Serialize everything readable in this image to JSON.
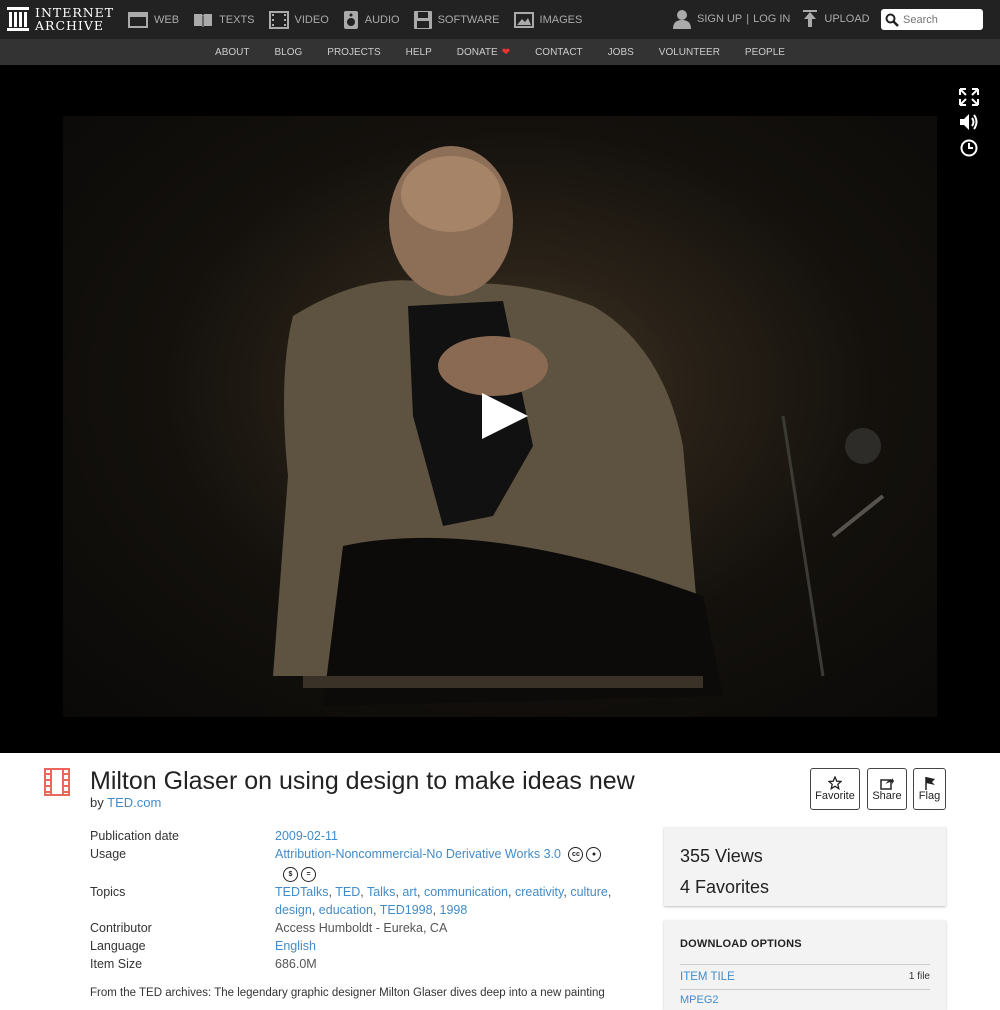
{
  "header": {
    "logo_line1": "INTERNET",
    "logo_line2": "ARCHIVE",
    "media": [
      {
        "label": "WEB",
        "icon": "web-icon"
      },
      {
        "label": "TEXTS",
        "icon": "texts-icon"
      },
      {
        "label": "VIDEO",
        "icon": "video-icon"
      },
      {
        "label": "AUDIO",
        "icon": "audio-icon"
      },
      {
        "label": "SOFTWARE",
        "icon": "software-icon"
      },
      {
        "label": "IMAGES",
        "icon": "images-icon"
      }
    ],
    "sign_up": "SIGN UP",
    "separator": "|",
    "log_in": "LOG IN",
    "upload": "UPLOAD",
    "search_placeholder": "Search"
  },
  "subnav": [
    "ABOUT",
    "BLOG",
    "PROJECTS",
    "HELP",
    "DONATE",
    "CONTACT",
    "JOBS",
    "VOLUNTEER",
    "PEOPLE"
  ],
  "player": {
    "controls": [
      "fullscreen-icon",
      "volume-icon",
      "clock-icon"
    ]
  },
  "item": {
    "title": "Milton Glaser on using design to make ideas new",
    "by_label": "by",
    "creator": "TED.com",
    "actions": [
      {
        "label": "Favorite",
        "icon": "star-icon"
      },
      {
        "label": "Share",
        "icon": "share-icon"
      },
      {
        "label": "Flag",
        "icon": "flag-icon"
      }
    ],
    "metadata": {
      "publication_date_label": "Publication date",
      "publication_date": "2009-02-11",
      "usage_label": "Usage",
      "usage": "Attribution-Noncommercial-No Derivative Works 3.0",
      "topics_label": "Topics",
      "topics": [
        "TEDTalks",
        "TED",
        "Talks",
        "art",
        "communication",
        "creativity",
        "culture",
        "design",
        "education",
        "TED1998",
        "1998"
      ],
      "contributor_label": "Contributor",
      "contributor": "Access Humboldt - Eureka, CA",
      "language_label": "Language",
      "language": "English",
      "item_size_label": "Item Size",
      "item_size": "686.0M"
    },
    "description": "From the TED archives: The legendary graphic designer Milton Glaser dives deep into a new painting",
    "stats": {
      "views": "355 Views",
      "favorites": "4 Favorites"
    },
    "downloads": {
      "title": "DOWNLOAD OPTIONS",
      "item_tile": "ITEM TILE",
      "item_tile_count": "1 file",
      "next": "MPEG2"
    }
  },
  "colors": {
    "topbar": "#222222",
    "subnav": "#333333",
    "link": "#428bca",
    "heart": "#e33333",
    "film_icon": "#e8695b"
  }
}
